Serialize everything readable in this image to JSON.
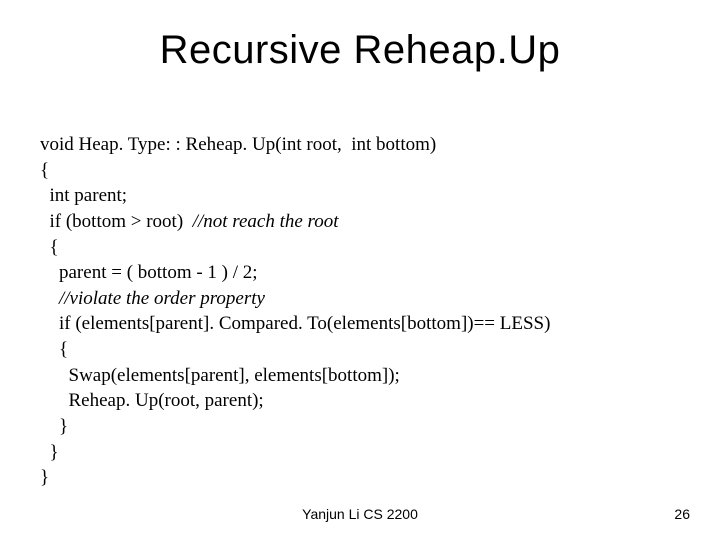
{
  "title": "Recursive Reheap.Up",
  "code": {
    "l1": "void Heap. Type: : Reheap. Up(int root,  int bottom)",
    "l2": "{",
    "l3": "  int parent;",
    "l4a": "  if (bottom > root)  ",
    "l4b": "//not reach the root",
    "l5": "  {",
    "l6": "    parent = ( bottom - 1 ) / 2;",
    "l7": "    //violate the order property",
    "l8": "    if (elements[parent]. Compared. To(elements[bottom])== LESS)",
    "l9": "    {",
    "l10": "      Swap(elements[parent], elements[bottom]);",
    "l11": "      Reheap. Up(root, parent);",
    "l12": "    }",
    "l13": "  }",
    "l14": "}"
  },
  "footer": {
    "center": "Yanjun Li CS 2200",
    "right": "26"
  }
}
